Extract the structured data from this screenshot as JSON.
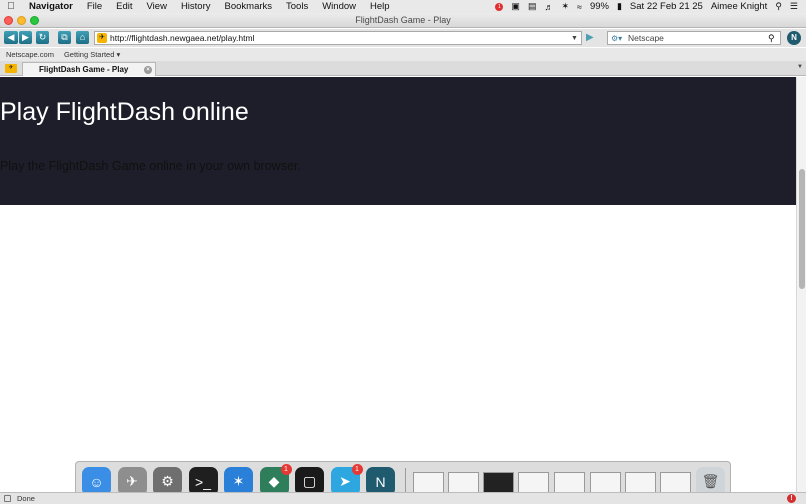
{
  "menubar": {
    "app_name": "Navigator",
    "items": [
      "File",
      "Edit",
      "View",
      "History",
      "Bookmarks",
      "Tools",
      "Window",
      "Help"
    ],
    "notification_count": "1",
    "battery": "99%",
    "datetime": "Sat 22 Feb  21 25",
    "user": "Aimee Knight"
  },
  "window": {
    "title": "FlightDash Game - Play"
  },
  "toolbar": {
    "url": "http://flightdash.newgaea.net/play.html",
    "search_placeholder": "Netscape"
  },
  "bookmarks": [
    "Netscape.com",
    "Getting Started ▾"
  ],
  "tab": {
    "label": "FlightDash Game - Play"
  },
  "page": {
    "heading": "Play FlightDash online",
    "subheading": "Play the FlightDash Game online in your own browser."
  },
  "dock": {
    "apps": [
      {
        "name": "finder-icon",
        "glyph": "☺",
        "color": "#3a8ee6"
      },
      {
        "name": "launchpad-icon",
        "glyph": "✈",
        "color": "#8e8e8e"
      },
      {
        "name": "system-preferences-icon",
        "glyph": "⚙",
        "color": "#6f6f6f"
      },
      {
        "name": "terminal-icon",
        "glyph": ">_",
        "color": "#1f1f1f"
      },
      {
        "name": "safari-icon",
        "glyph": "✶",
        "color": "#2a7fd8"
      },
      {
        "name": "security-shield-icon",
        "glyph": "◆",
        "color": "#2e7d5b",
        "badge": "1"
      },
      {
        "name": "square-app-icon",
        "glyph": "▢",
        "color": "#1a1a1a"
      },
      {
        "name": "telegram-icon",
        "glyph": "➤",
        "color": "#2ea6e0",
        "badge": "1"
      },
      {
        "name": "netscape-icon",
        "glyph": "N",
        "color": "#1f5a6e"
      }
    ]
  },
  "status": {
    "text": "Done"
  }
}
